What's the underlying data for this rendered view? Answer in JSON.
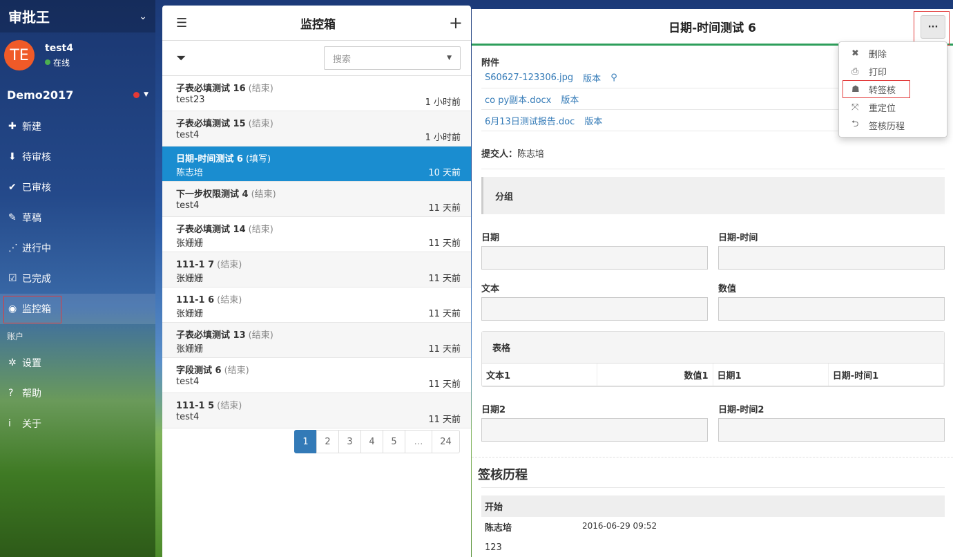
{
  "sidebar": {
    "app_title": "审批王",
    "user": {
      "initials": "TE",
      "name": "test4",
      "status": "在线"
    },
    "org": "Demo2017",
    "menu": [
      {
        "icon": "plus-icon",
        "glyph": "✚",
        "label": "新建"
      },
      {
        "icon": "inbox-icon",
        "glyph": "⬇",
        "label": "待审核"
      },
      {
        "icon": "double-check-icon",
        "glyph": "✔",
        "label": "已审核"
      },
      {
        "icon": "edit-icon",
        "glyph": "✎",
        "label": "草稿"
      },
      {
        "icon": "spinner-icon",
        "glyph": "⋰",
        "label": "进行中"
      },
      {
        "icon": "checkbox-icon",
        "glyph": "☑",
        "label": "已完成"
      },
      {
        "icon": "eye-icon",
        "glyph": "◉",
        "label": "监控箱"
      }
    ],
    "section_account": "账户",
    "account_menu": [
      {
        "icon": "gear-icon",
        "glyph": "✲",
        "label": "设置"
      },
      {
        "icon": "help-icon",
        "glyph": "?",
        "label": "帮助"
      },
      {
        "icon": "info-icon",
        "glyph": "i",
        "label": "关于"
      }
    ]
  },
  "list": {
    "title": "监控箱",
    "search_placeholder": "搜索",
    "items": [
      {
        "title": "子表必填测试 16",
        "status": "(结束)",
        "user": "test23",
        "time": "1 小时前"
      },
      {
        "title": "子表必填测试 15",
        "status": "(结束)",
        "user": "test4",
        "time": "1 小时前"
      },
      {
        "title": "日期-时间测试 6",
        "status": "(填写)",
        "user": "陈志培",
        "time": "10 天前"
      },
      {
        "title": "下一步权限测试 4",
        "status": "(结束)",
        "user": "test4",
        "time": "11 天前"
      },
      {
        "title": "子表必填测试 14",
        "status": "(结束)",
        "user": "张姗姗",
        "time": "11 天前"
      },
      {
        "title": "111-1 7",
        "status": "(结束)",
        "user": "张姗姗",
        "time": "11 天前"
      },
      {
        "title": "111-1 6",
        "status": "(结束)",
        "user": "张姗姗",
        "time": "11 天前"
      },
      {
        "title": "子表必填测试 13",
        "status": "(结束)",
        "user": "张姗姗",
        "time": "11 天前"
      },
      {
        "title": "字段测试 6",
        "status": "(结束)",
        "user": "test4",
        "time": "11 天前"
      },
      {
        "title": "111-1 5",
        "status": "(结束)",
        "user": "test4",
        "time": "11 天前"
      }
    ],
    "pages": [
      "1",
      "2",
      "3",
      "4",
      "5",
      "…",
      "24"
    ]
  },
  "detail": {
    "title": "日期-时间测试 6",
    "more_label": "···",
    "attachments_label": "附件",
    "attachments": [
      {
        "name": "S60627-123306.jpg",
        "version": "版本"
      },
      {
        "name": "co py副本.docx",
        "version": "版本"
      },
      {
        "name": "6月13日测试报告.doc",
        "version": "版本"
      }
    ],
    "submitter_label": "提交人：",
    "submitter": "陈志培",
    "group_label": "分组",
    "fields": {
      "date": "日期",
      "datetime": "日期-时间",
      "text": "文本",
      "number": "数值",
      "date2": "日期2",
      "datetime2": "日期-时间2"
    },
    "table": {
      "label": "表格",
      "columns": [
        "文本1",
        "数值1",
        "日期1",
        "日期-时间1"
      ]
    },
    "history": {
      "title": "签核历程",
      "stage": "开始",
      "user": "陈志培",
      "date": "2016-06-29 09:52",
      "note": "123"
    }
  },
  "dropdown": [
    {
      "icon": "delete-icon",
      "glyph": "✖",
      "label": "删除"
    },
    {
      "icon": "print-icon",
      "glyph": "⎙",
      "label": "打印"
    },
    {
      "icon": "transfer-user-icon",
      "glyph": "☗",
      "label": "转签核"
    },
    {
      "icon": "relocate-icon",
      "glyph": "⤧",
      "label": "重定位"
    },
    {
      "icon": "history-icon",
      "glyph": "⮌",
      "label": "签核历程"
    }
  ]
}
